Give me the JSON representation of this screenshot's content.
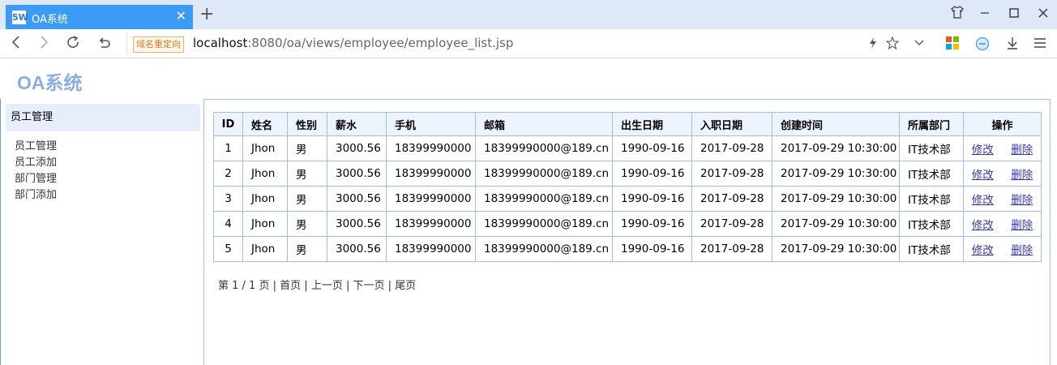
{
  "browser": {
    "tab_title": "OA系统",
    "tab_favicon": "5W",
    "new_tab": "+",
    "redirect_badge": "域名重定向",
    "url_host": "localhost",
    "url_rest": ":8080/oa/views/employee/employee_list.jsp",
    "icons": [
      "back-icon",
      "forward-icon",
      "reload-icon",
      "undo-icon",
      "lightning-icon",
      "star-icon",
      "chevron-down-icon",
      "apps-icon",
      "minus-circle-icon",
      "download-icon",
      "menu-icon",
      "shirt-icon",
      "minimize-icon",
      "maximize-icon",
      "close-icon"
    ]
  },
  "header": {
    "brand": "OA系统"
  },
  "sidebar": {
    "section_title": "员工管理",
    "items": [
      {
        "label": "员工管理"
      },
      {
        "label": "员工添加"
      },
      {
        "label": "部门管理"
      },
      {
        "label": "部门添加"
      }
    ]
  },
  "table": {
    "headers": [
      "ID",
      "姓名",
      "性别",
      "薪水",
      "手机",
      "邮箱",
      "出生日期",
      "入职日期",
      "创建时间",
      "所属部门",
      "操作"
    ],
    "rows": [
      {
        "id": "1",
        "name": "Jhon",
        "gender": "男",
        "salary": "3000.56",
        "phone": "18399990000",
        "email": "18399990000@189.cn",
        "birth": "1990-09-16",
        "hire": "2017-09-28",
        "created": "2017-09-29 10:30:00",
        "dept": "IT技术部",
        "edit": "修改",
        "delete": "删除"
      },
      {
        "id": "2",
        "name": "Jhon",
        "gender": "男",
        "salary": "3000.56",
        "phone": "18399990000",
        "email": "18399990000@189.cn",
        "birth": "1990-09-16",
        "hire": "2017-09-28",
        "created": "2017-09-29 10:30:00",
        "dept": "IT技术部",
        "edit": "修改",
        "delete": "删除"
      },
      {
        "id": "3",
        "name": "Jhon",
        "gender": "男",
        "salary": "3000.56",
        "phone": "18399990000",
        "email": "18399990000@189.cn",
        "birth": "1990-09-16",
        "hire": "2017-09-28",
        "created": "2017-09-29 10:30:00",
        "dept": "IT技术部",
        "edit": "修改",
        "delete": "删除"
      },
      {
        "id": "4",
        "name": "Jhon",
        "gender": "男",
        "salary": "3000.56",
        "phone": "18399990000",
        "email": "18399990000@189.cn",
        "birth": "1990-09-16",
        "hire": "2017-09-28",
        "created": "2017-09-29 10:30:00",
        "dept": "IT技术部",
        "edit": "修改",
        "delete": "删除"
      },
      {
        "id": "5",
        "name": "Jhon",
        "gender": "男",
        "salary": "3000.56",
        "phone": "18399990000",
        "email": "18399990000@189.cn",
        "birth": "1990-09-16",
        "hire": "2017-09-28",
        "created": "2017-09-29 10:30:00",
        "dept": "IT技术部",
        "edit": "修改",
        "delete": "删除"
      }
    ]
  },
  "pager": {
    "info": "第 1 / 1 页",
    "first": "首页",
    "prev": "上一页",
    "next": "下一页",
    "last": "尾页",
    "sep": "|"
  },
  "colors": {
    "accent": "#3b9bf5",
    "brand": "#8aaee0",
    "border": "#9cc0e3",
    "link": "#3b38a8"
  }
}
